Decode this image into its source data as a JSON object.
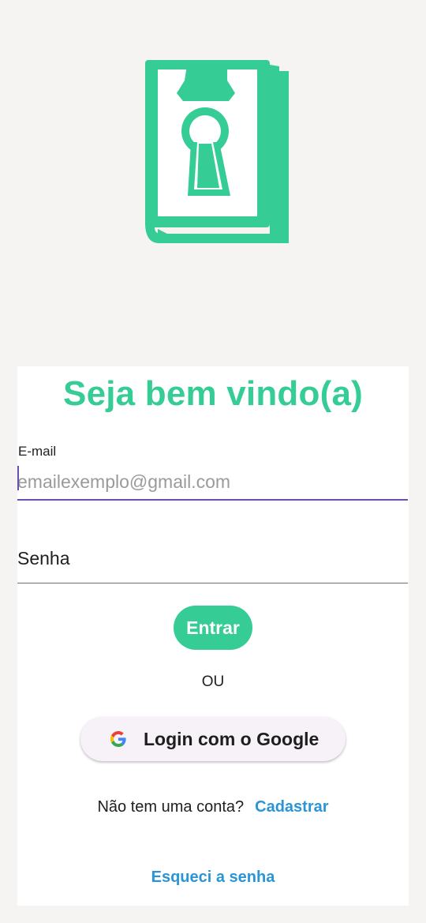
{
  "app": {
    "logo_icon": "book-keyhole-icon",
    "accent_color": "#36cc95",
    "link_color": "#2a95d6",
    "focus_color": "#6a4fb3"
  },
  "login": {
    "title": "Seja bem vindo(a)",
    "email": {
      "label": "E-mail",
      "placeholder": "emailexemplo@gmail.com",
      "value": ""
    },
    "password": {
      "placeholder": "Senha",
      "value": ""
    },
    "submit_label": "Entrar",
    "divider_label": "OU",
    "google": {
      "icon": "google-icon",
      "label": "Login com o Google"
    },
    "signup": {
      "question": "Não tem uma conta?",
      "link_label": "Cadastrar"
    },
    "forgot_label": "Esqueci a senha"
  }
}
